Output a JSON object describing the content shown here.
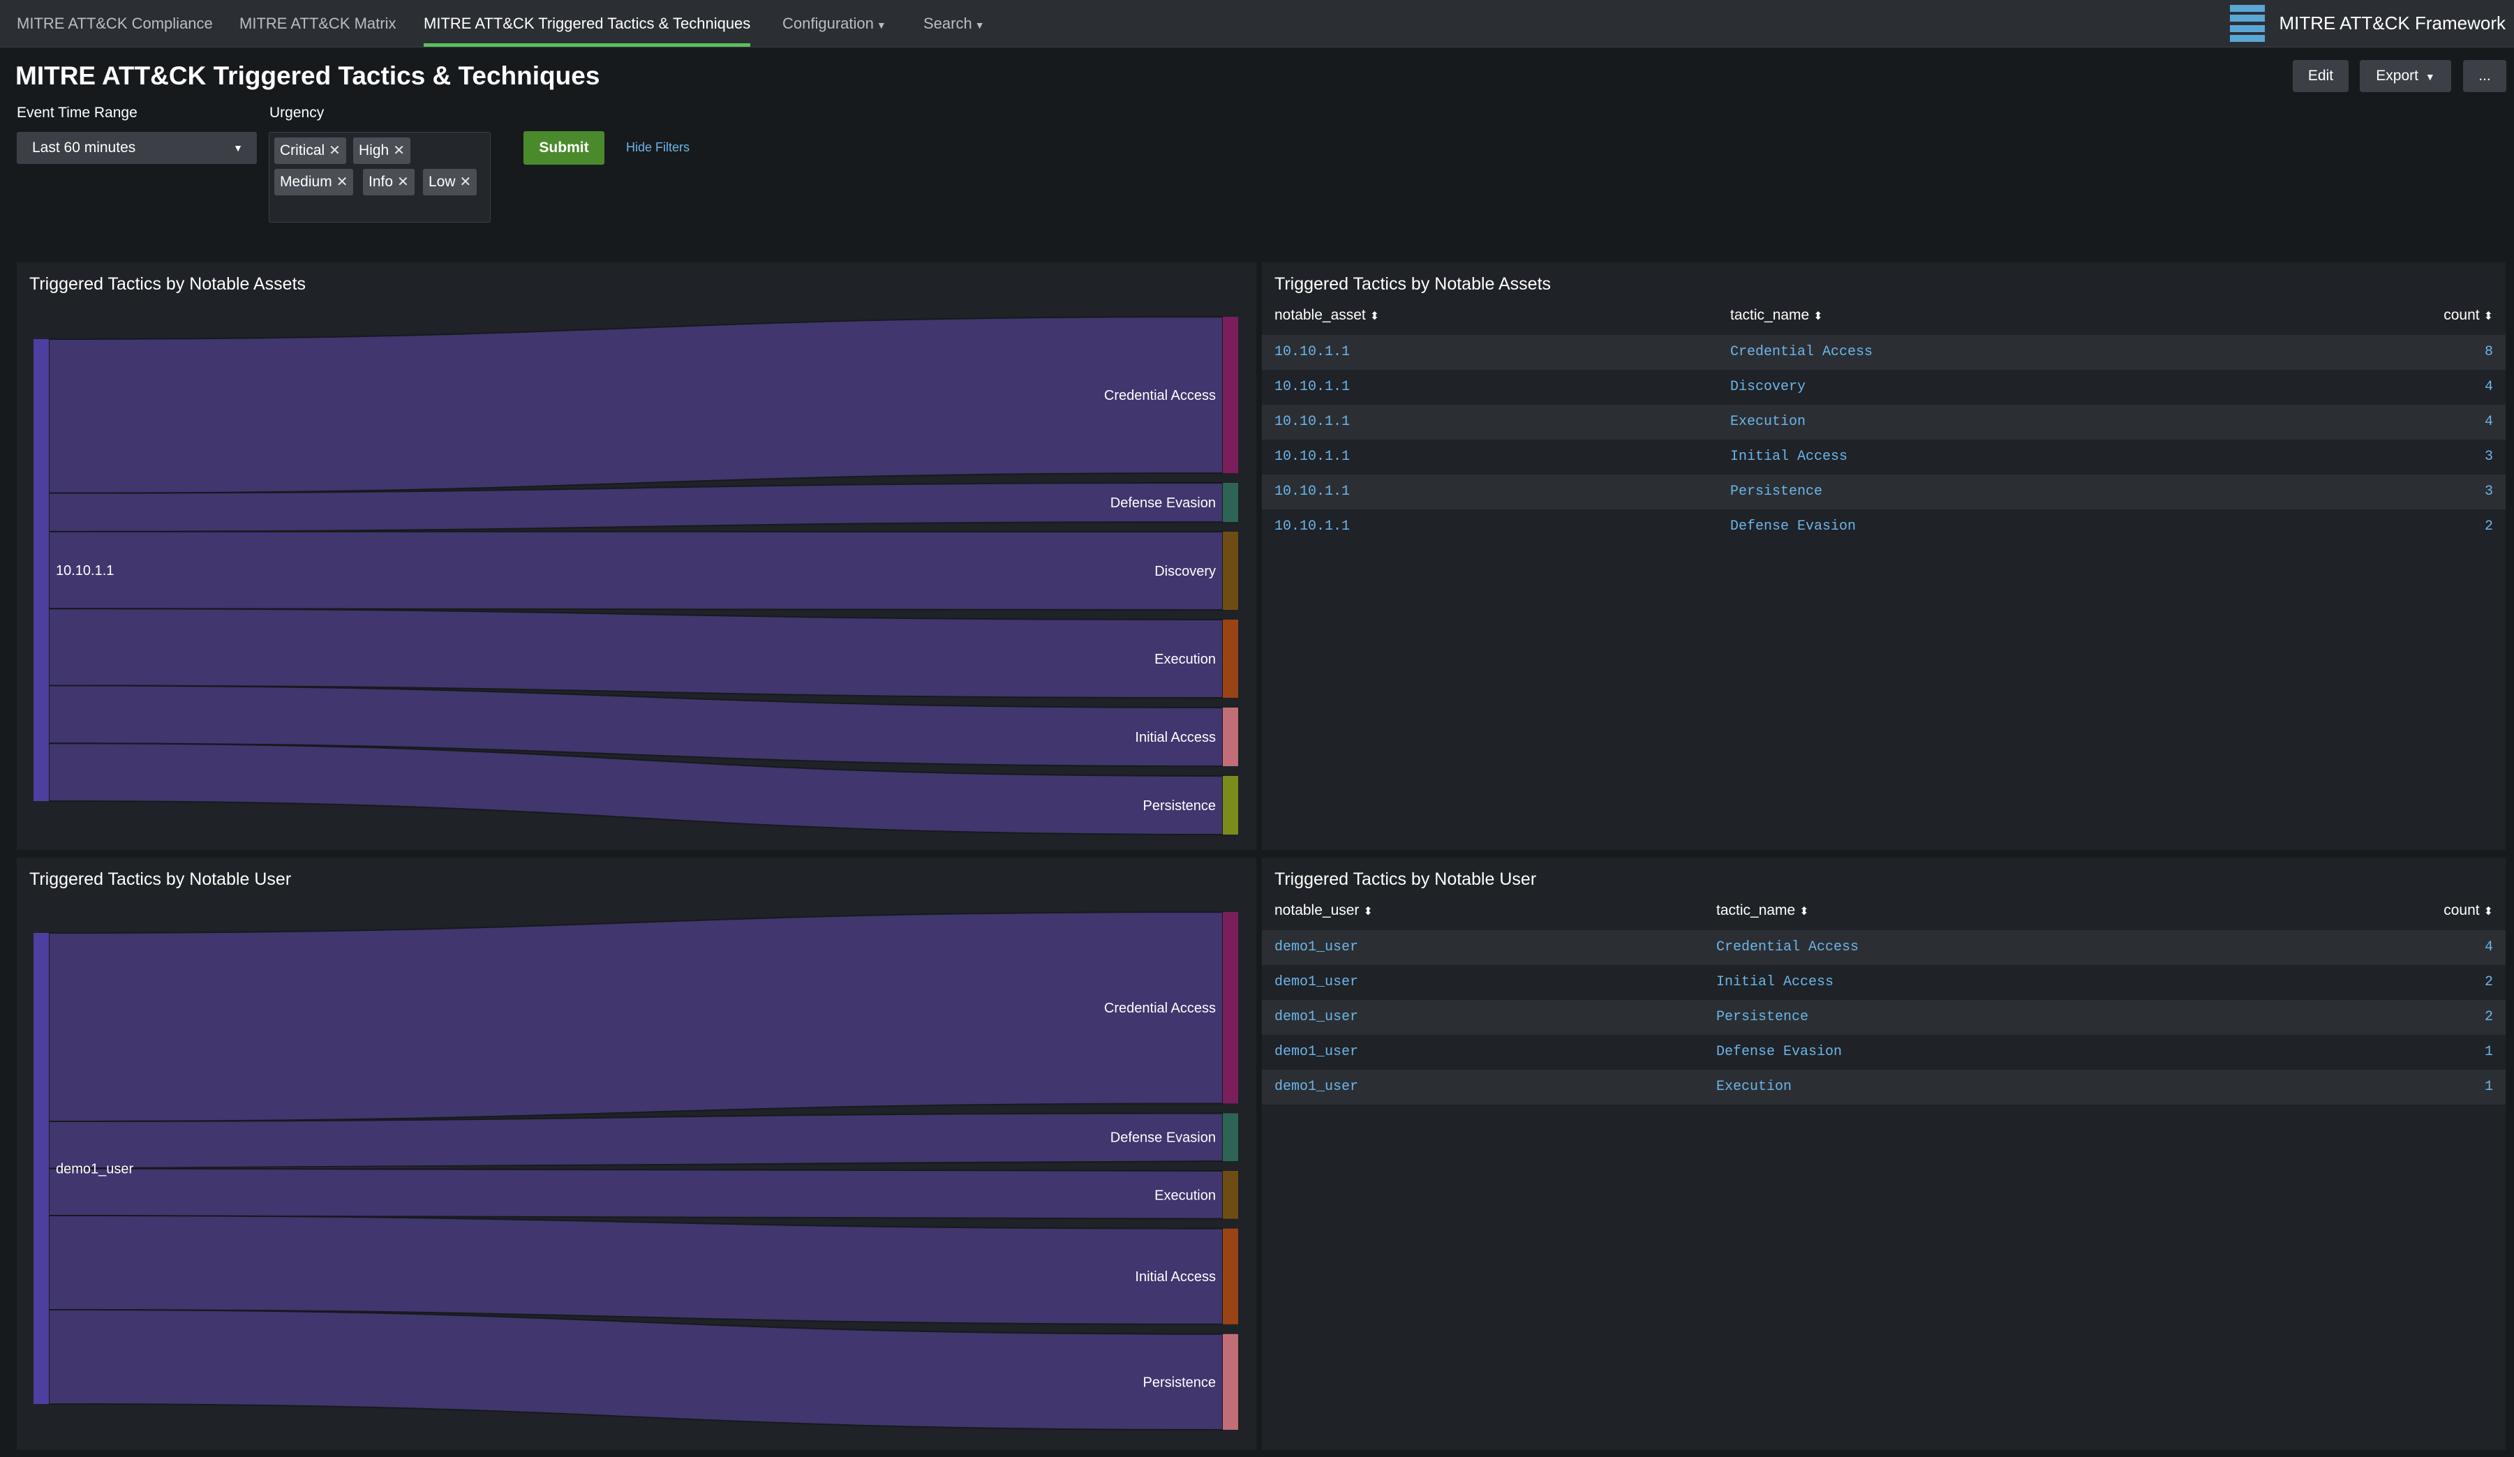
{
  "nav": {
    "tabs": [
      {
        "label": "MITRE ATT&CK Compliance"
      },
      {
        "label": "MITRE ATT&CK Matrix"
      },
      {
        "label": "MITRE ATT&CK Triggered Tactics & Techniques"
      },
      {
        "label": "Configuration"
      },
      {
        "label": "Search"
      }
    ],
    "active_tab": 2,
    "brand": "MITRE ATT&CK Framework"
  },
  "header": {
    "title": "MITRE ATT&CK Triggered Tactics & Techniques",
    "edit_label": "Edit",
    "export_label": "Export",
    "more_label": "..."
  },
  "filters": {
    "time_range_label": "Event Time Range",
    "time_range_value": "Last 60 minutes",
    "urgency_label": "Urgency",
    "urgency_tokens": [
      "Critical",
      "High",
      "Medium",
      "Info",
      "Low"
    ],
    "submit_label": "Submit",
    "hide_label": "Hide Filters"
  },
  "panels": {
    "assets_chart": {
      "title": "Triggered Tactics by Notable Assets",
      "source": "10.10.1.1",
      "flows": [
        {
          "target": "Credential Access",
          "value": 8,
          "color": "#7a1f5c"
        },
        {
          "target": "Defense Evasion",
          "value": 2,
          "color": "#2e6456"
        },
        {
          "target": "Discovery",
          "value": 4,
          "color": "#6e4d14"
        },
        {
          "target": "Execution",
          "value": 4,
          "color": "#9a4416"
        },
        {
          "target": "Initial Access",
          "value": 3,
          "color": "#c26e78"
        },
        {
          "target": "Persistence",
          "value": 3,
          "color": "#7b8c1c"
        }
      ]
    },
    "assets_table": {
      "title": "Triggered Tactics by Notable Assets",
      "columns": [
        "notable_asset",
        "tactic_name",
        "count"
      ],
      "rows": [
        [
          "10.10.1.1",
          "Credential Access",
          "8"
        ],
        [
          "10.10.1.1",
          "Discovery",
          "4"
        ],
        [
          "10.10.1.1",
          "Execution",
          "4"
        ],
        [
          "10.10.1.1",
          "Initial Access",
          "3"
        ],
        [
          "10.10.1.1",
          "Persistence",
          "3"
        ],
        [
          "10.10.1.1",
          "Defense Evasion",
          "2"
        ]
      ]
    },
    "user_chart": {
      "title": "Triggered Tactics by Notable User",
      "source": "demo1_user",
      "flows": [
        {
          "target": "Credential Access",
          "value": 4,
          "color": "#7a1f5c"
        },
        {
          "target": "Defense Evasion",
          "value": 1,
          "color": "#2e6456"
        },
        {
          "target": "Execution",
          "value": 1,
          "color": "#6e4d14"
        },
        {
          "target": "Initial Access",
          "value": 2,
          "color": "#9a4416"
        },
        {
          "target": "Persistence",
          "value": 2,
          "color": "#c26e78"
        }
      ]
    },
    "user_table": {
      "title": "Triggered Tactics by Notable User",
      "columns": [
        "notable_user",
        "tactic_name",
        "count"
      ],
      "rows": [
        [
          "demo1_user",
          "Credential Access",
          "4"
        ],
        [
          "demo1_user",
          "Initial Access",
          "2"
        ],
        [
          "demo1_user",
          "Persistence",
          "2"
        ],
        [
          "demo1_user",
          "Defense Evasion",
          "1"
        ],
        [
          "demo1_user",
          "Execution",
          "1"
        ]
      ]
    }
  },
  "colors": {
    "flow": "#433872",
    "source_node": "#4d3fa0",
    "link": "#6cb5ea",
    "submit": "#4a8a2d",
    "active_tab_underline": "#5cc05c"
  }
}
